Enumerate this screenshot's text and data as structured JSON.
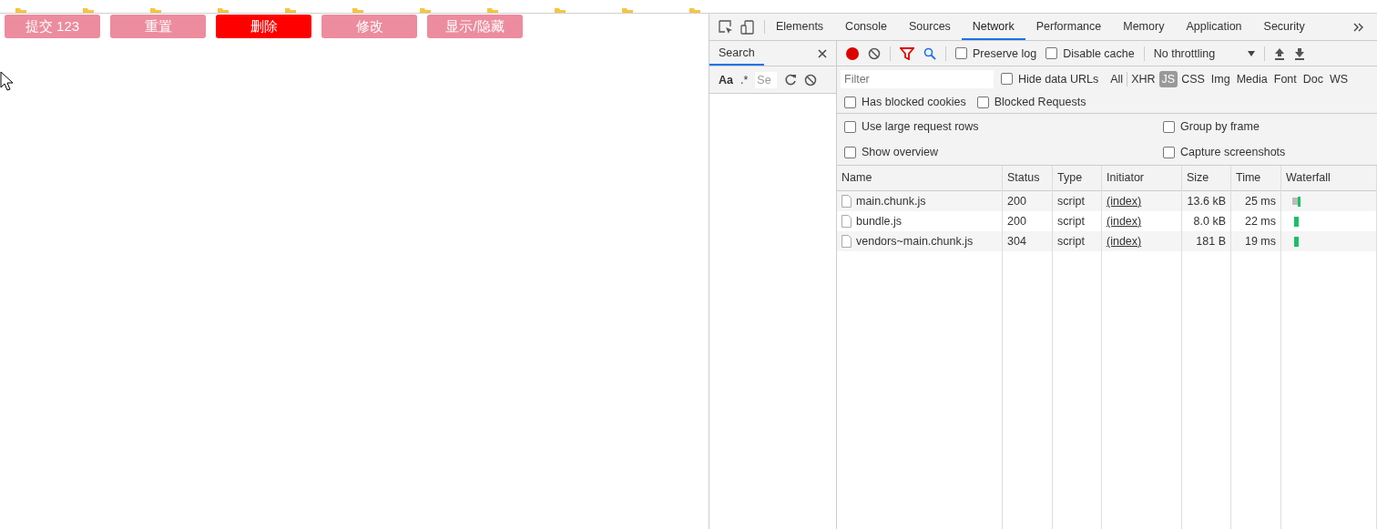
{
  "page": {
    "buttons": [
      {
        "label": "提交 123",
        "selected": false
      },
      {
        "label": "重置",
        "selected": false
      },
      {
        "label": "删除",
        "selected": true
      },
      {
        "label": "修改",
        "selected": false
      },
      {
        "label": "显示/隐藏",
        "selected": false
      }
    ]
  },
  "devtools": {
    "tabs": [
      {
        "label": "Elements",
        "selected": false
      },
      {
        "label": "Console",
        "selected": false
      },
      {
        "label": "Sources",
        "selected": false
      },
      {
        "label": "Network",
        "selected": true
      },
      {
        "label": "Performance",
        "selected": false
      },
      {
        "label": "Memory",
        "selected": false
      },
      {
        "label": "Application",
        "selected": false
      },
      {
        "label": "Security",
        "selected": false
      }
    ],
    "search_panel": {
      "title": "Search",
      "match_case": "Aa",
      "regex": ".*",
      "placeholder": "Se"
    },
    "toolbar": {
      "recording": true,
      "checkboxes": [
        {
          "label": "Preserve log",
          "checked": false
        },
        {
          "label": "Disable cache",
          "checked": false
        }
      ],
      "throttling": "No throttling"
    },
    "filter": {
      "placeholder": "Filter",
      "hide_data_urls": {
        "label": "Hide data URLs",
        "checked": false
      },
      "types": [
        {
          "label": "All",
          "selected": false
        },
        {
          "label": "XHR",
          "selected": false
        },
        {
          "label": "JS",
          "selected": true
        },
        {
          "label": "CSS",
          "selected": false
        },
        {
          "label": "Img",
          "selected": false
        },
        {
          "label": "Media",
          "selected": false
        },
        {
          "label": "Font",
          "selected": false
        },
        {
          "label": "Doc",
          "selected": false
        },
        {
          "label": "WS",
          "selected": false
        }
      ],
      "blocked": [
        {
          "label": "Has blocked cookies",
          "checked": false
        },
        {
          "label": "Blocked Requests",
          "checked": false
        }
      ]
    },
    "settings": [
      {
        "label": "Use large request rows",
        "checked": false
      },
      {
        "label": "Group by frame",
        "checked": false
      },
      {
        "label": "Show overview",
        "checked": false
      },
      {
        "label": "Capture screenshots",
        "checked": false
      }
    ],
    "table": {
      "columns": [
        "Name",
        "Status",
        "Type",
        "Initiator",
        "Size",
        "Time",
        "Waterfall"
      ],
      "rows": [
        {
          "name": "main.chunk.js",
          "status": "200",
          "type": "script",
          "initiator": "(index)",
          "size": "13.6 kB",
          "time": "25 ms"
        },
        {
          "name": "bundle.js",
          "status": "200",
          "type": "script",
          "initiator": "(index)",
          "size": "8.0 kB",
          "time": "22 ms"
        },
        {
          "name": "vendors~main.chunk.js",
          "status": "304",
          "type": "script",
          "initiator": "(index)",
          "size": "181 B",
          "time": "19 ms"
        }
      ]
    }
  }
}
